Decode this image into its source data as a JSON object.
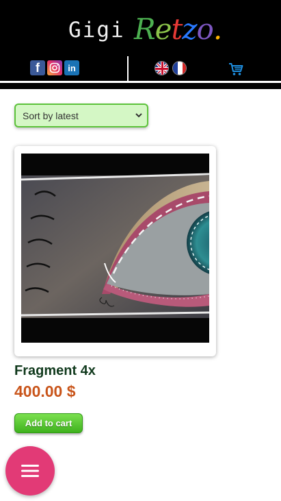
{
  "header": {
    "logo_first": "Gigi",
    "logo_letters": [
      {
        "ch": "R",
        "color": "#4caf50"
      },
      {
        "ch": "e",
        "color": "#8bc34a"
      },
      {
        "ch": "t",
        "color": "#e53935"
      },
      {
        "ch": "z",
        "color": "#2979ff"
      },
      {
        "ch": "o",
        "color": "#7e57c2"
      },
      {
        "ch": ".",
        "color": "#ffb300"
      }
    ],
    "social": [
      {
        "name": "facebook",
        "icon": "facebook-icon",
        "glyph": "f"
      },
      {
        "name": "instagram",
        "icon": "instagram-icon",
        "glyph": ""
      },
      {
        "name": "linkedin",
        "icon": "linkedin-icon",
        "glyph": "in"
      }
    ],
    "languages": [
      "english-flag-icon",
      "french-flag-icon"
    ],
    "cart_icon": "cart-icon",
    "accent_cart": "#1e8fe1"
  },
  "sort": {
    "selected": "Sort by latest"
  },
  "product": {
    "title": "Fragment 4x",
    "price": "400.00 $",
    "add_to_cart": "Add to cart",
    "colors": {
      "title": "#10391c",
      "price": "#c9551b",
      "button": "#4cc02a"
    }
  },
  "fab": {
    "icon": "menu-icon",
    "color": "#e23a76"
  }
}
